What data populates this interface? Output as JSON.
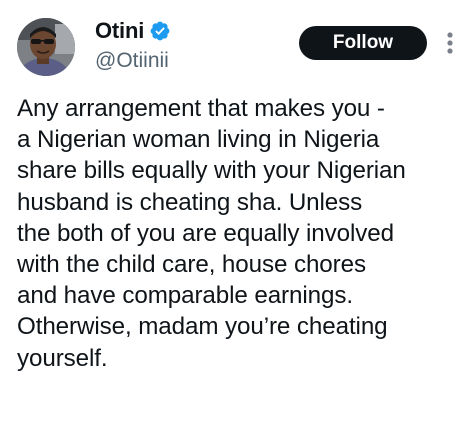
{
  "author": {
    "display_name": "Otini",
    "handle": "@Otiinii",
    "verified": true,
    "avatar_icon": "profile-photo"
  },
  "actions": {
    "follow_label": "Follow",
    "more_icon": "vertical-ellipsis-icon"
  },
  "tweet": {
    "lines": [
      "Any arrangement that makes you -",
      "a Nigerian woman living in Nigeria",
      "share bills equally with your Nigerian",
      "husband is cheating sha. Unless",
      "the both of you are equally involved",
      "with the child care, house chores",
      "and have comparable earnings.",
      "Otherwise, madam you’re cheating",
      "yourself."
    ]
  },
  "colors": {
    "text": "#0f1419",
    "secondary_text": "#536471",
    "verified_blue": "#1d9bf0",
    "button_bg": "#0f1419",
    "button_text": "#ffffff",
    "background": "#ffffff"
  }
}
